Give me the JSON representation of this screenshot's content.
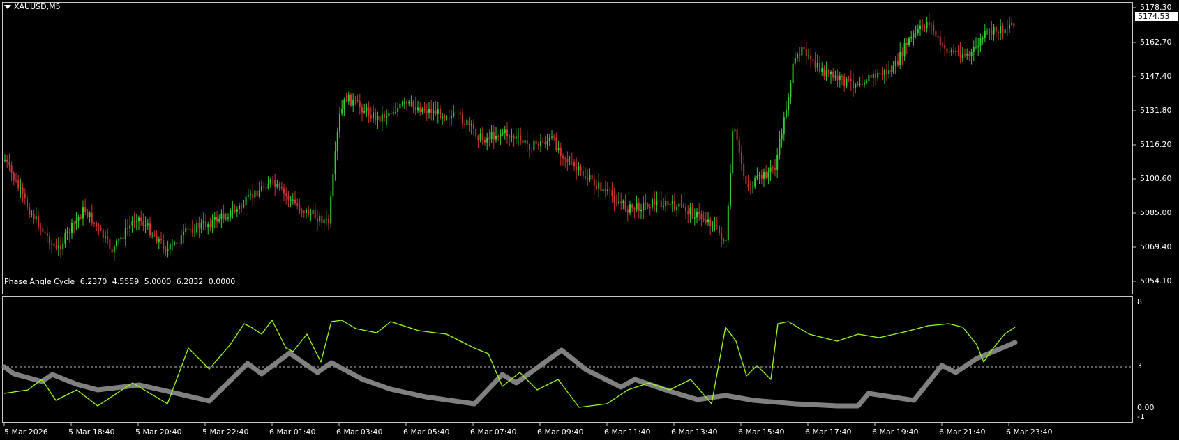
{
  "window": {
    "symbol": "XAUUSD,M5"
  },
  "price_axis": {
    "ticks": [
      "5178.30",
      "5162.70",
      "5147.40",
      "5131.80",
      "5116.20",
      "5100.60",
      "5085.00",
      "5069.40",
      "5054.10"
    ],
    "current_price": "5174.53"
  },
  "indicator": {
    "name": "Phase Angle Cycle",
    "values": [
      "6.2370",
      "4.5559",
      "5.0000",
      "6.2832",
      "0.0000"
    ],
    "axis_ticks": [
      "8",
      "3",
      "0.00",
      "-1"
    ]
  },
  "time_axis": {
    "labels": [
      "5 Mar 2026",
      "5 Mar 18:40",
      "5 Mar 20:40",
      "5 Mar 22:40",
      "6 Mar 01:40",
      "6 Mar 03:40",
      "6 Mar 05:40",
      "6 Mar 07:40",
      "6 Mar 09:40",
      "6 Mar 11:40",
      "6 Mar 13:40",
      "6 Mar 15:40",
      "6 Mar 17:40",
      "6 Mar 19:40",
      "6 Mar 21:40",
      "6 Mar 23:40"
    ]
  },
  "colors": {
    "bull": "#2fd02f",
    "bear": "#d23232",
    "phase_line": "#9aff1a",
    "cycle_line": "#808080",
    "grid": "#ffffff"
  }
}
